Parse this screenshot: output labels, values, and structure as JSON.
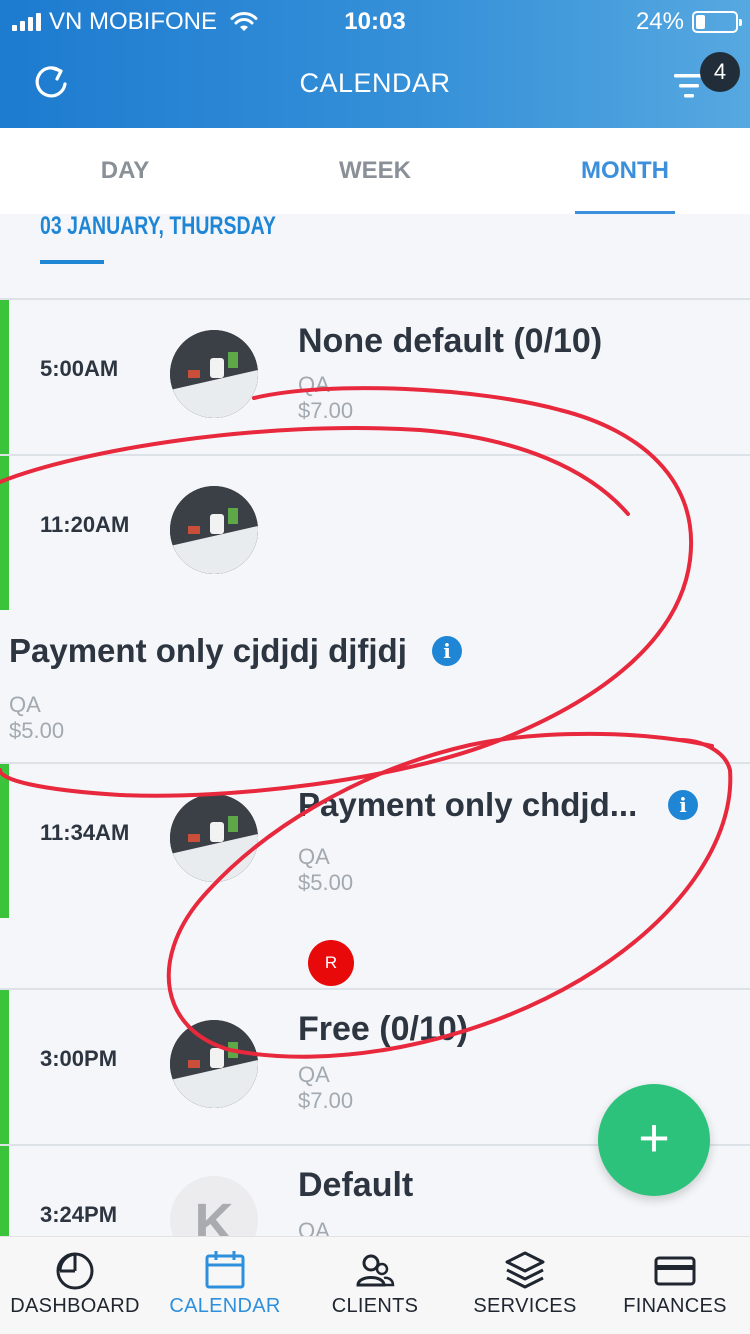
{
  "status_bar": {
    "carrier": "VN MOBIFONE",
    "time": "10:03",
    "battery": "24%",
    "battery_level": 0.24
  },
  "nav": {
    "title": "CALENDAR",
    "filter_badge": "4"
  },
  "tabs": [
    {
      "label": "DAY",
      "active": false
    },
    {
      "label": "WEEK",
      "active": false
    },
    {
      "label": "MONTH",
      "active": true
    }
  ],
  "date_header": "03 JANUARY, THURSDAY",
  "events": [
    {
      "time": "5:00AM",
      "title": "None default (0/10)",
      "category": "QA",
      "price": "$7.00"
    },
    {
      "time": "11:20AM",
      "title": "Payment only cjdjdj djfjdj",
      "category": "QA",
      "price": "$5.00"
    },
    {
      "time": "11:34AM",
      "title": "Payment only chdjd...",
      "category": "QA",
      "price": "$5.00",
      "staff_initial": "R"
    },
    {
      "time": "3:00PM",
      "title": "Free (0/10)",
      "category": "QA",
      "price": "$7.00"
    },
    {
      "time": "3:24PM",
      "title": "Default",
      "category": "QA",
      "avatar_initial": "K"
    }
  ],
  "fab_label": "+",
  "bottom_tabs": [
    {
      "label": "DASHBOARD",
      "icon": "pie-chart-icon"
    },
    {
      "label": "CALENDAR",
      "icon": "calendar-icon",
      "active": true
    },
    {
      "label": "CLIENTS",
      "icon": "users-icon"
    },
    {
      "label": "SERVICES",
      "icon": "layers-icon"
    },
    {
      "label": "FINANCES",
      "icon": "credit-card-icon"
    }
  ],
  "colors": {
    "header_start": "#1d7bd0",
    "accent": "#1f86d6",
    "event_bar": "#3bc43b",
    "fab": "#2dc27c",
    "annotation": "#e8283c"
  }
}
